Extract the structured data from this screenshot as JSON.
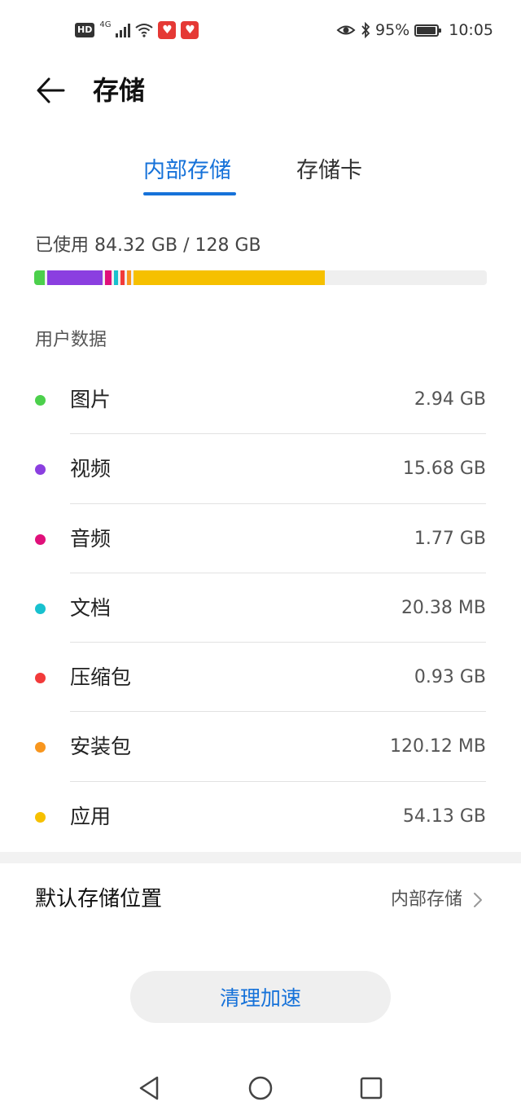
{
  "status_bar": {
    "hd": "HD",
    "network": "4G",
    "battery_percent": "95%",
    "battery_level": 0.95,
    "time": "10:05",
    "icons": [
      "hd-icon",
      "signal-icon",
      "wifi-icon",
      "app-notification-icon",
      "app-notification-icon",
      "eye-icon",
      "bluetooth-icon",
      "battery-icon"
    ]
  },
  "header": {
    "back_icon": "arrow-left-icon",
    "title": "存储"
  },
  "tabs": [
    {
      "label": "内部存储",
      "active": true
    },
    {
      "label": "存储卡",
      "active": false
    }
  ],
  "usage": {
    "text": "已使用 84.32 GB / 128 GB",
    "used_gb": 84.32,
    "total_gb": 128
  },
  "section_label": "用户数据",
  "categories": [
    {
      "name": "图片",
      "size": "2.94 GB",
      "color": "#4cd04c"
    },
    {
      "name": "视频",
      "size": "15.68 GB",
      "color": "#8b3fe0"
    },
    {
      "name": "音频",
      "size": "1.77 GB",
      "color": "#e0107a"
    },
    {
      "name": "文档",
      "size": "20.38 MB",
      "color": "#18c1cf"
    },
    {
      "name": "压缩包",
      "size": "0.93 GB",
      "color": "#f23a3a"
    },
    {
      "name": "安装包",
      "size": "120.12 MB",
      "color": "#f8961e"
    },
    {
      "name": "应用",
      "size": "54.13 GB",
      "color": "#f6c000"
    }
  ],
  "default_location": {
    "label": "默认存储位置",
    "value": "内部存储",
    "chevron_icon": "chevron-right-icon"
  },
  "clean_button": "清理加速",
  "nav": {
    "back_icon": "triangle-back-icon",
    "home_icon": "circle-home-icon",
    "recents_icon": "square-recents-icon"
  },
  "colors": {
    "accent": "#1672d9",
    "bar_background": "#efefef"
  }
}
